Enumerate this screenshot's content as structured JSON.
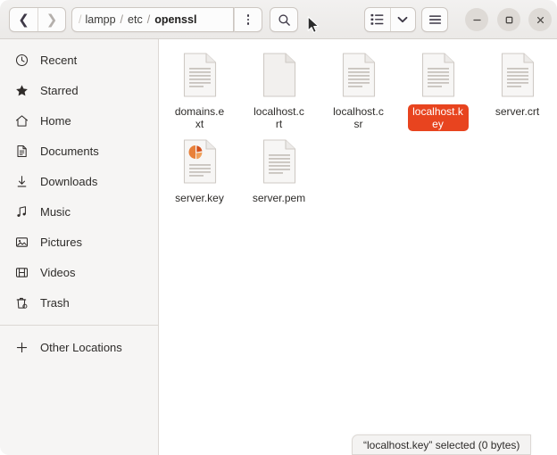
{
  "window": {
    "accent_color": "#e8441f",
    "sidebar_bg": "#f6f5f4",
    "header_bg": "#ebe9e7"
  },
  "header": {
    "back_icon": "chevron-left-icon",
    "forward_icon": "chevron-right-icon",
    "breadcrumb": {
      "truncated_marker": "/",
      "separator": "/",
      "items": [
        {
          "label": "lampp",
          "current": false
        },
        {
          "label": "etc",
          "current": false
        },
        {
          "label": "openssl",
          "current": true
        }
      ]
    },
    "path_menu_icon": "kebab-menu-icon",
    "search_icon": "search-icon",
    "view_list_icon": "list-view-icon",
    "view_dropdown_icon": "chevron-down-icon",
    "hamburger_icon": "hamburger-menu-icon",
    "window_controls": {
      "minimize_icon": "minimize-icon",
      "maximize_icon": "maximize-icon",
      "close_icon": "close-icon"
    }
  },
  "sidebar": {
    "items": [
      {
        "label": "Recent",
        "icon": "clock-icon"
      },
      {
        "label": "Starred",
        "icon": "star-icon"
      },
      {
        "label": "Home",
        "icon": "home-icon"
      },
      {
        "label": "Documents",
        "icon": "document-icon"
      },
      {
        "label": "Downloads",
        "icon": "download-icon"
      },
      {
        "label": "Music",
        "icon": "music-note-icon"
      },
      {
        "label": "Pictures",
        "icon": "picture-icon"
      },
      {
        "label": "Videos",
        "icon": "video-icon"
      },
      {
        "label": "Trash",
        "icon": "trash-icon"
      }
    ],
    "other_locations": {
      "label": "Other Locations",
      "icon": "plus-icon"
    }
  },
  "main": {
    "files": [
      {
        "name": "domains.ext",
        "icon": "text-document-icon",
        "selected": false
      },
      {
        "name": "localhost.crt",
        "icon": "blank-document-icon",
        "selected": false
      },
      {
        "name": "localhost.csr",
        "icon": "text-document-icon",
        "selected": false
      },
      {
        "name": "localhost.key",
        "icon": "text-document-icon",
        "selected": true
      },
      {
        "name": "server.crt",
        "icon": "text-document-icon",
        "selected": false
      },
      {
        "name": "server.key",
        "icon": "presentation-document-icon",
        "selected": false
      },
      {
        "name": "server.pem",
        "icon": "text-document-icon",
        "selected": false
      }
    ]
  },
  "statusbar": {
    "text": "“localhost.key” selected  (0 bytes)"
  }
}
